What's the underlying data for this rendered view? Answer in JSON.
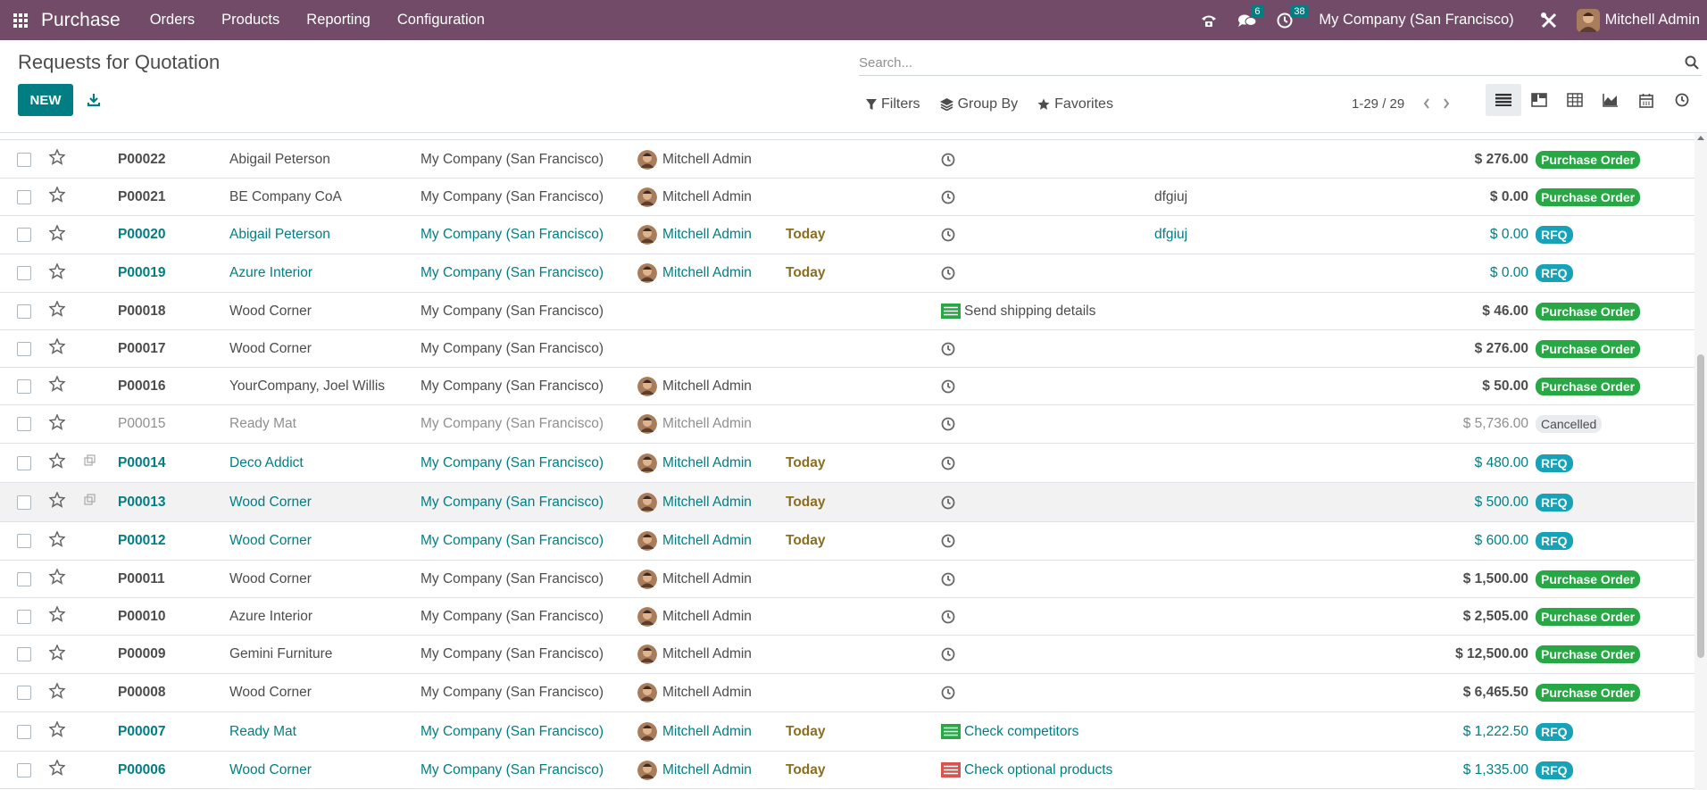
{
  "navbar": {
    "brand": "Purchase",
    "menus": [
      "Orders",
      "Products",
      "Reporting",
      "Configuration"
    ],
    "messages_count": "6",
    "activities_count": "38",
    "company": "My Company (San Francisco)",
    "user": "Mitchell Admin",
    "bg_color": "#714b67"
  },
  "control_panel": {
    "title": "Requests for Quotation",
    "new_label": "NEW",
    "search_placeholder": "Search...",
    "filters_label": "Filters",
    "groupby_label": "Group By",
    "favorites_label": "Favorites",
    "pager": "1-29 / 29",
    "views": [
      "list-view-icon",
      "kanban-view-icon",
      "pivot-view-icon",
      "graph-view-icon",
      "calendar-view-icon",
      "activity-view-icon"
    ],
    "active_view": "list"
  },
  "colors": {
    "accent": "#017e84",
    "purchase_order": "#28a745",
    "rfq": "#17a2b8",
    "cancelled": "#e9ecef",
    "deadline": "#8a6d1d"
  },
  "rows": [
    {
      "ref": "P00022",
      "vendor": "Abigail Peterson",
      "company": "My Company (San Francisco)",
      "buyer": "Mitchell Admin",
      "deadline": "",
      "activity": "",
      "origin": "",
      "total": "$ 276.00",
      "status": "Purchase Order",
      "kind": "po"
    },
    {
      "ref": "P00021",
      "vendor": "BE Company CoA",
      "company": "My Company (San Francisco)",
      "buyer": "Mitchell Admin",
      "deadline": "",
      "activity": "",
      "origin": "dfgiuj",
      "total": "$ 0.00",
      "status": "Purchase Order",
      "kind": "po"
    },
    {
      "ref": "P00020",
      "vendor": "Abigail Peterson",
      "company": "My Company (San Francisco)",
      "buyer": "Mitchell Admin",
      "deadline": "Today",
      "activity": "",
      "origin": "dfgiuj",
      "total": "$ 0.00",
      "status": "RFQ",
      "kind": "rfq"
    },
    {
      "ref": "P00019",
      "vendor": "Azure Interior",
      "company": "My Company (San Francisco)",
      "buyer": "Mitchell Admin",
      "deadline": "Today",
      "activity": "",
      "origin": "",
      "total": "$ 0.00",
      "status": "RFQ",
      "kind": "rfq"
    },
    {
      "ref": "P00018",
      "vendor": "Wood Corner",
      "company": "My Company (San Francisco)",
      "buyer": "",
      "deadline": "",
      "activity": "Send shipping details",
      "activity_color": "green",
      "origin": "",
      "total": "$ 46.00",
      "status": "Purchase Order",
      "kind": "po"
    },
    {
      "ref": "P00017",
      "vendor": "Wood Corner",
      "company": "My Company (San Francisco)",
      "buyer": "",
      "deadline": "",
      "activity": "",
      "origin": "",
      "total": "$ 276.00",
      "status": "Purchase Order",
      "kind": "po"
    },
    {
      "ref": "P00016",
      "vendor": "YourCompany, Joel Willis",
      "company": "My Company (San Francisco)",
      "buyer": "Mitchell Admin",
      "deadline": "",
      "activity": "",
      "origin": "",
      "total": "$ 50.00",
      "status": "Purchase Order",
      "kind": "po"
    },
    {
      "ref": "P00015",
      "vendor": "Ready Mat",
      "company": "My Company (San Francisco)",
      "buyer": "Mitchell Admin",
      "deadline": "",
      "activity": "",
      "origin": "",
      "total": "$ 5,736.00",
      "status": "Cancelled",
      "kind": "cancel"
    },
    {
      "ref": "P00014",
      "vendor": "Deco Addict",
      "company": "My Company (San Francisco)",
      "buyer": "Mitchell Admin",
      "deadline": "Today",
      "activity": "",
      "origin": "",
      "total": "$ 480.00",
      "status": "RFQ",
      "kind": "rfq",
      "copy": true
    },
    {
      "ref": "P00013",
      "vendor": "Wood Corner",
      "company": "My Company (San Francisco)",
      "buyer": "Mitchell Admin",
      "deadline": "Today",
      "activity": "",
      "origin": "",
      "total": "$ 500.00",
      "status": "RFQ",
      "kind": "rfq",
      "copy": true,
      "hover": true
    },
    {
      "ref": "P00012",
      "vendor": "Wood Corner",
      "company": "My Company (San Francisco)",
      "buyer": "Mitchell Admin",
      "deadline": "Today",
      "activity": "",
      "origin": "",
      "total": "$ 600.00",
      "status": "RFQ",
      "kind": "rfq"
    },
    {
      "ref": "P00011",
      "vendor": "Wood Corner",
      "company": "My Company (San Francisco)",
      "buyer": "Mitchell Admin",
      "deadline": "",
      "activity": "",
      "origin": "",
      "total": "$ 1,500.00",
      "status": "Purchase Order",
      "kind": "po"
    },
    {
      "ref": "P00010",
      "vendor": "Azure Interior",
      "company": "My Company (San Francisco)",
      "buyer": "Mitchell Admin",
      "deadline": "",
      "activity": "",
      "origin": "",
      "total": "$ 2,505.00",
      "status": "Purchase Order",
      "kind": "po"
    },
    {
      "ref": "P00009",
      "vendor": "Gemini Furniture",
      "company": "My Company (San Francisco)",
      "buyer": "Mitchell Admin",
      "deadline": "",
      "activity": "",
      "origin": "",
      "total": "$ 12,500.00",
      "status": "Purchase Order",
      "kind": "po"
    },
    {
      "ref": "P00008",
      "vendor": "Wood Corner",
      "company": "My Company (San Francisco)",
      "buyer": "Mitchell Admin",
      "deadline": "",
      "activity": "",
      "origin": "",
      "total": "$ 6,465.50",
      "status": "Purchase Order",
      "kind": "po"
    },
    {
      "ref": "P00007",
      "vendor": "Ready Mat",
      "company": "My Company (San Francisco)",
      "buyer": "Mitchell Admin",
      "deadline": "Today",
      "activity": "Check competitors",
      "activity_color": "green",
      "origin": "",
      "total": "$ 1,222.50",
      "status": "RFQ",
      "kind": "rfq"
    },
    {
      "ref": "P00006",
      "vendor": "Wood Corner",
      "company": "My Company (San Francisco)",
      "buyer": "Mitchell Admin",
      "deadline": "Today",
      "activity": "Check optional products",
      "activity_color": "red",
      "origin": "",
      "total": "$ 1,335.00",
      "status": "RFQ",
      "kind": "rfq"
    }
  ]
}
